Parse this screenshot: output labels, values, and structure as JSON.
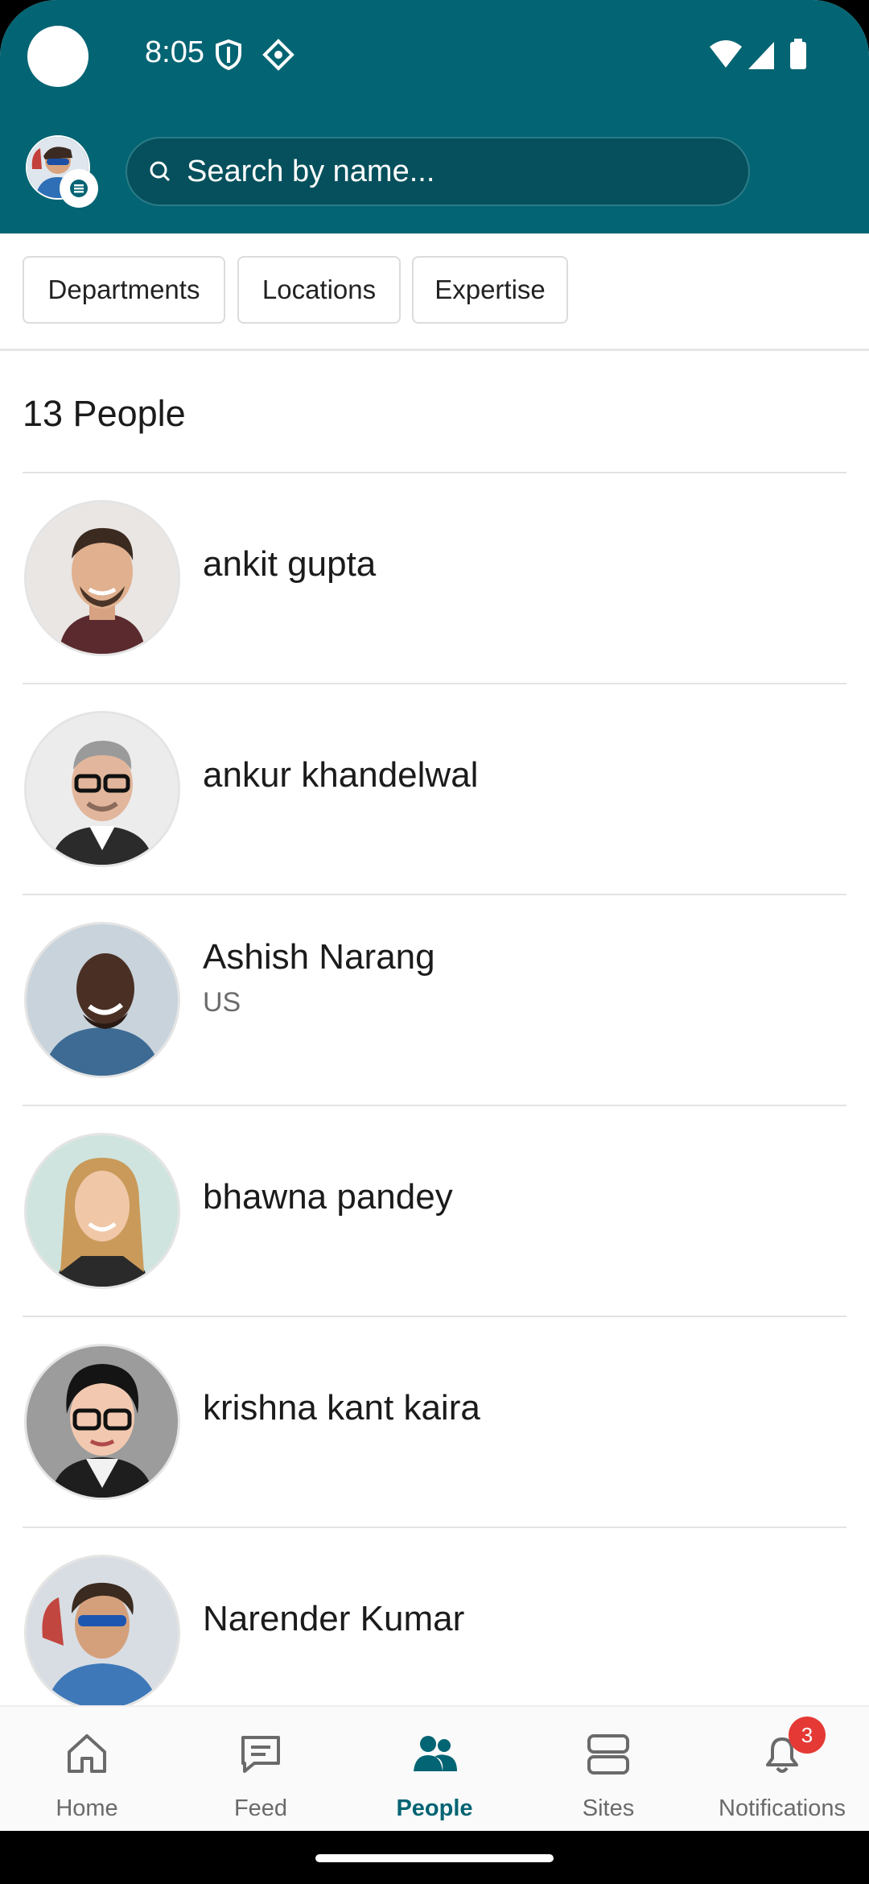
{
  "status": {
    "time": "8:05"
  },
  "header": {
    "search_placeholder": "Search by name..."
  },
  "filters": [
    "Departments",
    "Locations",
    "Expertise"
  ],
  "people_count_label": "13 People",
  "people": [
    {
      "name": "ankit gupta",
      "subtitle": ""
    },
    {
      "name": "ankur khandelwal",
      "subtitle": ""
    },
    {
      "name": "Ashish Narang",
      "subtitle": "US"
    },
    {
      "name": "bhawna pandey",
      "subtitle": ""
    },
    {
      "name": "krishna kant kaira",
      "subtitle": ""
    },
    {
      "name": "Narender Kumar",
      "subtitle": ""
    }
  ],
  "nav": {
    "items": [
      {
        "label": "Home",
        "icon": "home-icon"
      },
      {
        "label": "Feed",
        "icon": "chat-icon"
      },
      {
        "label": "People",
        "icon": "people-icon",
        "active": true
      },
      {
        "label": "Sites",
        "icon": "sites-icon"
      },
      {
        "label": "Notifications",
        "icon": "bell-icon"
      }
    ],
    "notifications_badge": "3"
  },
  "colors": {
    "header_bg": "#036473",
    "accent": "#036473",
    "badge": "#e53935"
  }
}
